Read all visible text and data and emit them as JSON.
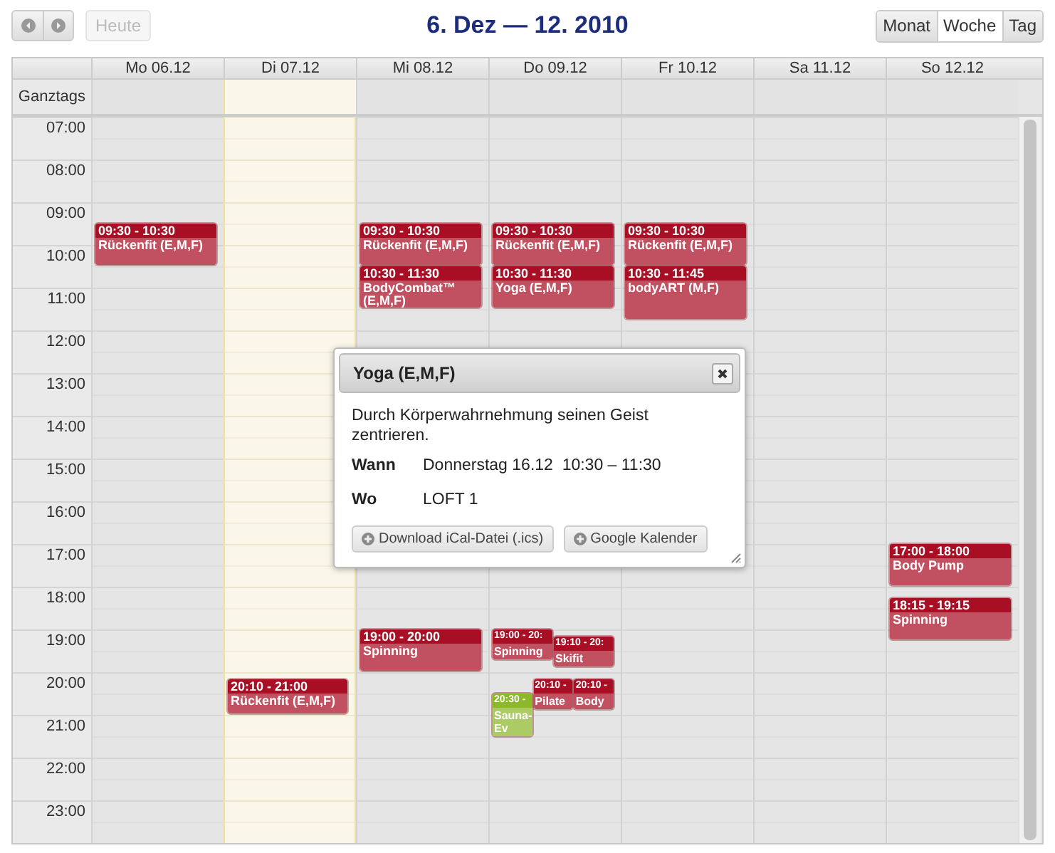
{
  "toolbar": {
    "today_button": {
      "label": "Heute",
      "disabled": true
    },
    "title": "6. Dez — 12. 2010",
    "views": [
      {
        "label": "Monat",
        "selected": false
      },
      {
        "label": "Woche",
        "selected": true
      },
      {
        "label": "Tag",
        "selected": false
      }
    ]
  },
  "calendar": {
    "allday_label": "Ganztags",
    "hours": [
      "07:00",
      "08:00",
      "09:00",
      "10:00",
      "11:00",
      "12:00",
      "13:00",
      "14:00",
      "15:00",
      "16:00",
      "17:00",
      "18:00",
      "19:00",
      "20:00",
      "21:00",
      "22:00",
      "23:00"
    ],
    "days": [
      {
        "label": "Mo 06.12",
        "today": false,
        "events": [
          {
            "time": "09:30 - 10:30",
            "title": "Rückenfit (E,M,F)",
            "color": "#a90f24"
          }
        ]
      },
      {
        "label": "Di 07.12",
        "today": true,
        "events": [
          {
            "time": "20:10 - 21:00",
            "title": "Rückenfit (E,M,F)",
            "color": "#a90f24"
          }
        ]
      },
      {
        "label": "Mi 08.12",
        "today": false,
        "events": [
          {
            "time": "09:30 - 10:30",
            "title": "Rückenfit (E,M,F)",
            "color": "#a90f24"
          },
          {
            "time": "10:30 - 11:30",
            "title": "BodyCombat™ (E,M,F)",
            "color": "#a90f24"
          },
          {
            "time": "19:00 - 20:00",
            "title": "Spinning",
            "color": "#a90f24"
          }
        ]
      },
      {
        "label": "Do 09.12",
        "today": false,
        "events": [
          {
            "time": "09:30 - 10:30",
            "title": "Rückenfit (E,M,F)",
            "color": "#a90f24"
          },
          {
            "time": "10:30 - 11:30",
            "title": "Yoga (E,M,F)",
            "color": "#a90f24"
          },
          {
            "time": "19:00 - 20:",
            "title": "Spinning",
            "color": "#a90f24"
          },
          {
            "time": "19:10 - 20:",
            "title": "Skifit",
            "color": "#a90f24"
          },
          {
            "time": "20:30 -",
            "title": "Sauna-Ev",
            "color": "#8cb82a"
          },
          {
            "time": "20:10 -",
            "title": "Pilate",
            "color": "#a90f24"
          },
          {
            "time": "20:10 -",
            "title": "Body",
            "color": "#a90f24"
          }
        ]
      },
      {
        "label": "Fr 10.12",
        "today": false,
        "events": [
          {
            "time": "09:30 - 10:30",
            "title": "Rückenfit (E,M,F)",
            "color": "#a90f24"
          },
          {
            "time": "10:30 - 11:45",
            "title": "bodyART (M,F)",
            "color": "#a90f24"
          }
        ]
      },
      {
        "label": "Sa 11.12",
        "today": false
      },
      {
        "label": "So 12.12",
        "today": false,
        "events": [
          {
            "time": "17:00 - 18:00",
            "title": "Body Pump",
            "color": "#a90f24"
          },
          {
            "time": "18:15 - 19:15",
            "title": "Spinning",
            "color": "#a90f24"
          }
        ]
      }
    ]
  },
  "popup": {
    "title": "Yoga (E,M,F)",
    "description": "Durch Körperwahrnehmung seinen Geist zentrieren.",
    "details": [
      {
        "label": "Wann",
        "value": "Donnerstag 16.12  10:30 – 11:30"
      },
      {
        "label": "Wo",
        "value": "LOFT 1"
      }
    ],
    "buttons": [
      "Download iCal-Datei (.ics)",
      "Google Kalender"
    ]
  }
}
